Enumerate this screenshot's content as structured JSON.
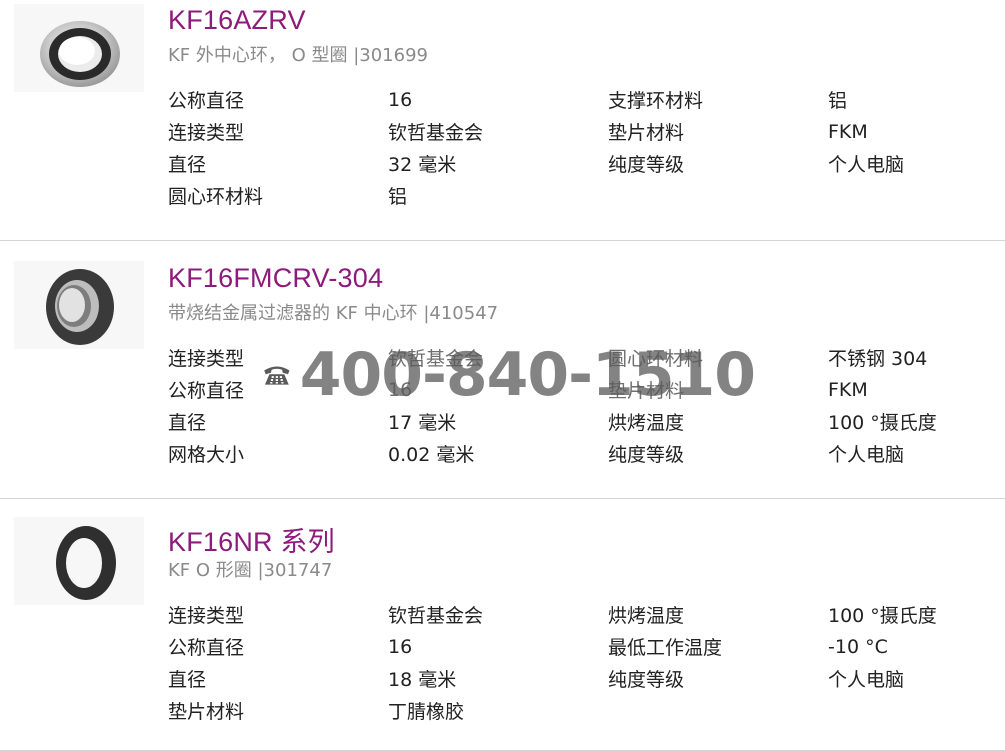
{
  "colors": {
    "title": "#8e1a7c",
    "subtitle": "#8a8a8a",
    "divider": "#d4d4d4",
    "text": "#222222",
    "watermark": "#5a5a5a"
  },
  "watermark": {
    "icon": "telephone-icon",
    "text": "400-840-1510"
  },
  "products": [
    {
      "title": "KF16AZRV",
      "subtitle": "KF 外中心环， O 型圈 |301699",
      "image_icon": "centering-ring-product-image",
      "specs": [
        [
          "公称直径",
          "16",
          "支撑环材料",
          "铝"
        ],
        [
          "连接类型",
          "钦哲基金会",
          "垫片材料",
          "FKM"
        ],
        [
          "直径",
          "32 毫米",
          "纯度等级",
          "个人电脑"
        ],
        [
          "圆心环材料",
          "铝",
          "",
          ""
        ]
      ]
    },
    {
      "title": "KF16FMCRV-304",
      "subtitle": "带烧结金属过滤器的 KF 中心环 |410547",
      "image_icon": "filter-centering-ring-product-image",
      "specs": [
        [
          "连接类型",
          "钦哲基金会",
          "圆心环材料",
          "不锈钢 304"
        ],
        [
          "公称直径",
          "16",
          "垫片材料",
          "FKM"
        ],
        [
          "直径",
          "17 毫米",
          "烘烤温度",
          "100 °摄氏度"
        ],
        [
          "网格大小",
          "0.02 毫米",
          "纯度等级",
          "个人电脑"
        ]
      ]
    },
    {
      "title": "KF16NR 系列",
      "subtitle": "KF O 形圈 |301747",
      "image_icon": "o-ring-product-image",
      "specs": [
        [
          "连接类型",
          "钦哲基金会",
          "烘烤温度",
          "100 °摄氏度"
        ],
        [
          "公称直径",
          "16",
          "最低工作温度",
          "-10 °C"
        ],
        [
          "直径",
          "18 毫米",
          "纯度等级",
          "个人电脑"
        ],
        [
          "垫片材料",
          "丁腈橡胶",
          "",
          ""
        ]
      ]
    }
  ]
}
